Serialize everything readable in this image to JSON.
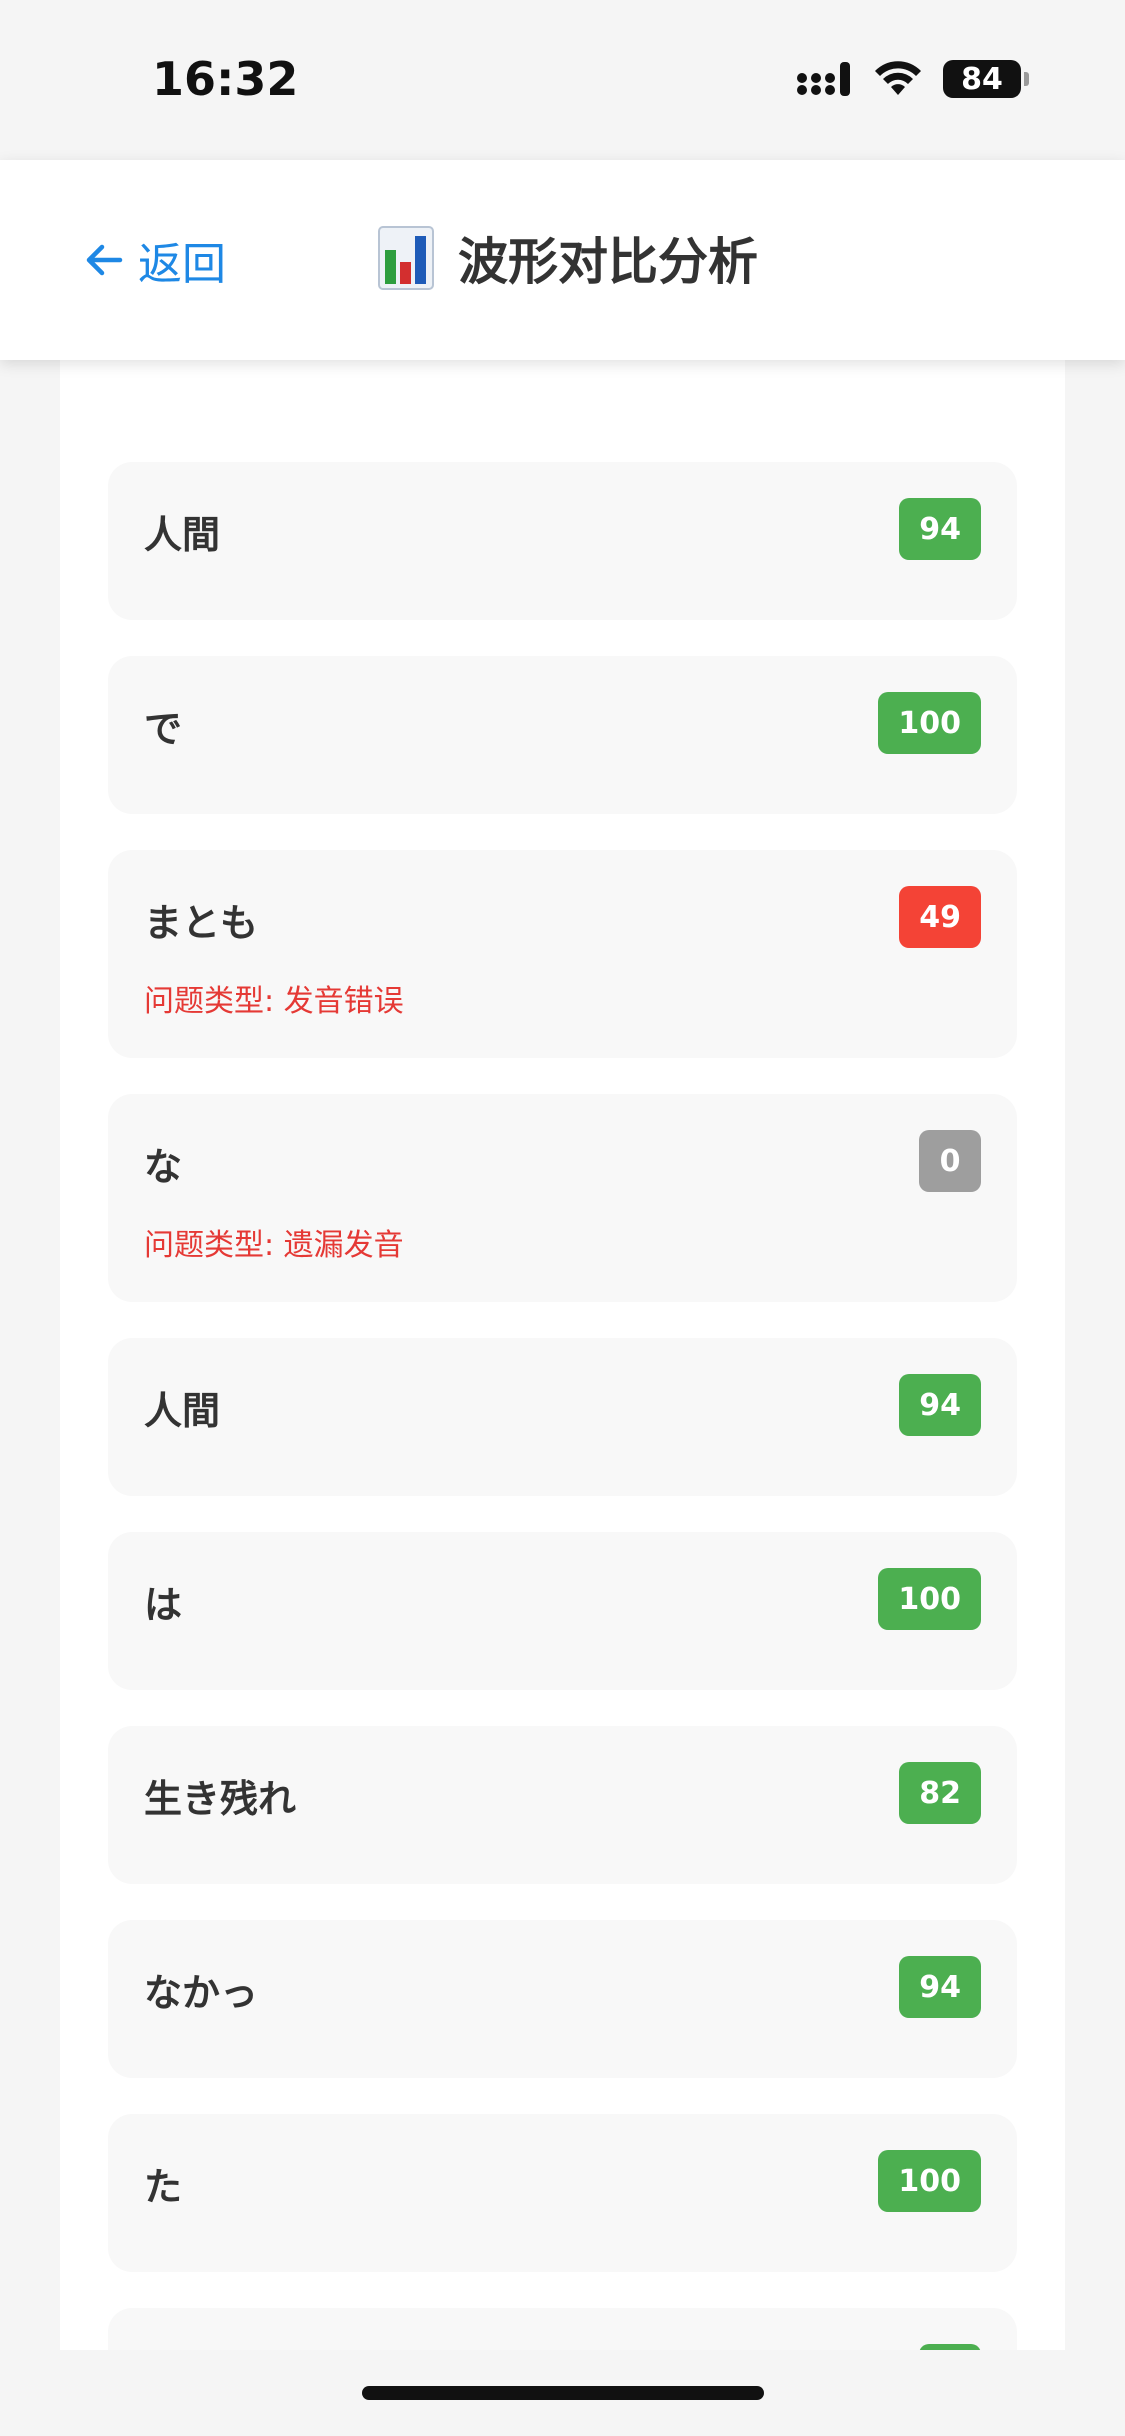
{
  "status_bar": {
    "time": "16:32",
    "battery": "84"
  },
  "header": {
    "back_label": "返回",
    "title": "波形对比分析"
  },
  "words": [
    {
      "word": "",
      "score": ""
    },
    {
      "word": "人間",
      "score": "94"
    },
    {
      "word": "で",
      "score": "100"
    },
    {
      "word": "まとも",
      "score": "49",
      "issue": "问题类型: 发音错误"
    },
    {
      "word": "な",
      "score": "0",
      "issue": "问题类型: 遗漏发音"
    },
    {
      "word": "人間",
      "score": "94"
    },
    {
      "word": "は",
      "score": "100"
    },
    {
      "word": "生き残れ",
      "score": "82"
    },
    {
      "word": "なかっ",
      "score": "94"
    },
    {
      "word": "た",
      "score": "100"
    },
    {
      "word": "",
      "score": ""
    }
  ],
  "colors": {
    "good": "#4caf50",
    "bad": "#f44336",
    "missing": "#9e9e9e",
    "accent": "#1e88e5",
    "issue": "#e53935"
  }
}
